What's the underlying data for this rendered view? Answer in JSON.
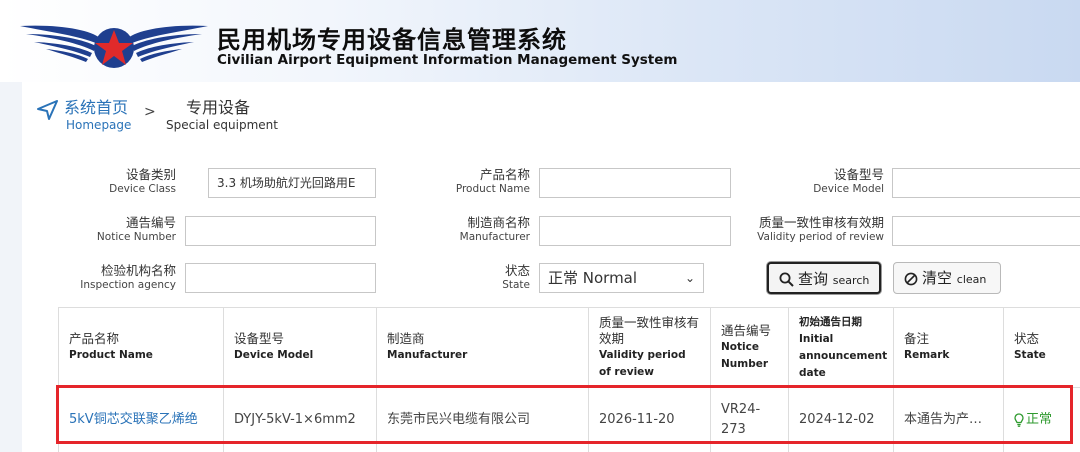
{
  "header": {
    "title_cn": "民用机场专用设备信息管理系统",
    "title_en": "Civilian Airport Equipment Information Management System"
  },
  "breadcrumb": {
    "home_cn": "系统首页",
    "home_en": "Homepage",
    "separator": ">",
    "current_cn": "专用设备",
    "current_en": "Special equipment"
  },
  "filters": {
    "device_class": {
      "label_cn": "设备类别",
      "label_en": "Device Class",
      "value": "3.3 机场助航灯光回路用E"
    },
    "product_name": {
      "label_cn": "产品名称",
      "label_en": "Product Name",
      "value": ""
    },
    "device_model": {
      "label_cn": "设备型号",
      "label_en": "Device Model",
      "value": ""
    },
    "notice_number": {
      "label_cn": "通告编号",
      "label_en": "Notice Number",
      "value": ""
    },
    "manufacturer": {
      "label_cn": "制造商名称",
      "label_en": "Manufacturer",
      "value": ""
    },
    "validity": {
      "label_cn": "质量一致性审核有效期",
      "label_en": "Validity period of review",
      "value": ""
    },
    "inspection_agency": {
      "label_cn": "检验机构名称",
      "label_en": "Inspection agency",
      "value": ""
    },
    "state": {
      "label_cn": "状态",
      "label_en": "State",
      "selected": "正常 Normal"
    }
  },
  "buttons": {
    "search_cn": "查询",
    "search_en": "search",
    "clean_cn": "清空",
    "clean_en": "clean"
  },
  "table": {
    "headers": [
      {
        "cn": "产品名称",
        "en": "Product Name"
      },
      {
        "cn": "设备型号",
        "en": "Device Model"
      },
      {
        "cn": "制造商",
        "en": "Manufacturer"
      },
      {
        "cn": "质量一致性审核有效期",
        "en": "Validity period of review"
      },
      {
        "cn": "通告编号",
        "en": "Notice Number"
      },
      {
        "cn": "",
        "en": "初始通告日期 Initial announcement date"
      },
      {
        "cn": "备注",
        "en": "Remark"
      },
      {
        "cn": "状态",
        "en": "State"
      }
    ],
    "rows": [
      {
        "product_name": "5kV铜芯交联聚乙烯绝",
        "device_model": "DYJY-5kV-1×6mm2",
        "manufacturer": "东莞市民兴电缆有限公司",
        "validity": "2026-11-20",
        "notice_number": "VR24-273",
        "initial_date": "2024-12-02",
        "remark": "本通告为产…",
        "state": "正常"
      }
    ]
  },
  "colors": {
    "link": "#2a73b8",
    "highlight": "#e5252a",
    "state_ok": "#2e9a2e"
  }
}
